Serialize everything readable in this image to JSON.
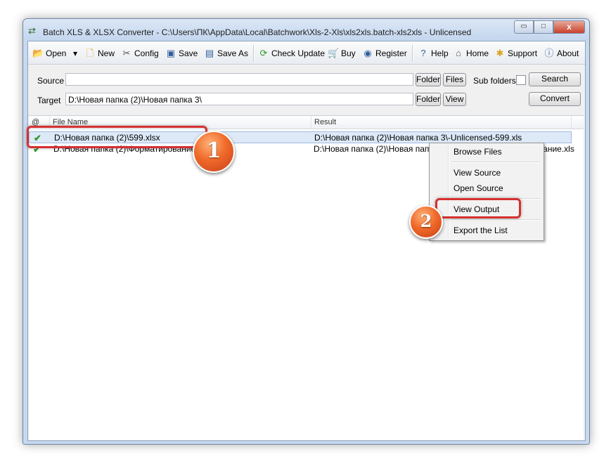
{
  "window": {
    "title": "Batch XLS & XLSX Converter - C:\\Users\\ПК\\AppData\\Local\\Batchwork\\Xls-2-Xls\\xls2xls.batch-xls2xls - Unlicensed",
    "min_glyph": "▭",
    "max_glyph": "□",
    "close_glyph": "x"
  },
  "toolbar": {
    "open": "Open",
    "new": "New",
    "config": "Config",
    "save": "Save",
    "save_as": "Save As",
    "check_update": "Check Update",
    "buy": "Buy",
    "register": "Register",
    "help": "Help",
    "home": "Home",
    "support": "Support",
    "about": "About",
    "dropdown_glyph": "▾"
  },
  "form": {
    "source_label": "Source",
    "source_value": "",
    "target_label": "Target",
    "target_value": "D:\\Новая папка (2)\\Новая папка 3\\",
    "folder_button": "Folder",
    "files_button": "Files",
    "subfolders_label": "Sub folders",
    "search_button": "Search",
    "target_folder_button": "Folder",
    "view_button": "View",
    "convert_button": "Convert"
  },
  "list": {
    "columns": [
      "@",
      "File Name",
      "Result"
    ],
    "rows": [
      {
        "status": "✔",
        "file": "D:\\Новая папка (2)\\599.xlsx",
        "result": "D:\\Новая папка (2)\\Новая папка 3\\-Unlicensed-599.xls"
      },
      {
        "status": "✔",
        "file": "D:\\Новая папка (2)\\Форматирование.xlsx",
        "result": "D:\\Новая папка (2)\\Новая папка 3\\-Unlicensed-Форматирование.xls"
      }
    ]
  },
  "context_menu": {
    "items": [
      "Browse Files",
      "View  Source",
      "Open Source",
      "View  Output",
      "Export the List"
    ]
  },
  "callouts": {
    "badge1": "1",
    "badge2": "2"
  },
  "colors": {
    "callout_border": "#d63030",
    "badge_orange": "#f06a2a",
    "selection": "#dde9f7"
  }
}
